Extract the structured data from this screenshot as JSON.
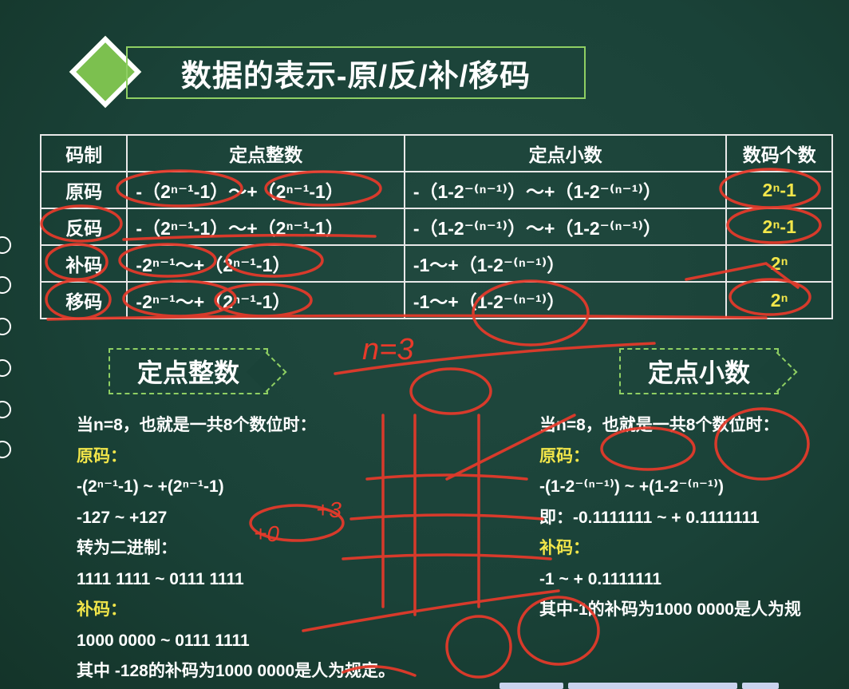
{
  "title": "数据的表示-原/反/补/移码",
  "table": {
    "headers": [
      "码制",
      "定点整数",
      "定点小数",
      "数码个数"
    ],
    "rows": [
      {
        "code": "原码",
        "int_range": "-（2ⁿ⁻¹-1）～+（2ⁿ⁻¹-1）",
        "dec_range": "-（1-2⁻⁽ⁿ⁻¹⁾）～+（1-2⁻⁽ⁿ⁻¹⁾）",
        "count": "2ⁿ-1"
      },
      {
        "code": "反码",
        "int_range": "-（2ⁿ⁻¹-1）～+（2ⁿ⁻¹-1）",
        "dec_range": "-（1-2⁻⁽ⁿ⁻¹⁾）～+（1-2⁻⁽ⁿ⁻¹⁾）",
        "count": "2ⁿ-1"
      },
      {
        "code": "补码",
        "int_range": "-2ⁿ⁻¹～+（2ⁿ⁻¹-1）",
        "dec_range": "-1～+（1-2⁻⁽ⁿ⁻¹⁾）",
        "count": "2ⁿ"
      },
      {
        "code": "移码",
        "int_range": "-2ⁿ⁻¹～+（2ⁿ⁻¹-1）",
        "dec_range": "-1～+（1-2⁻⁽ⁿ⁻¹⁾）",
        "count": "2ⁿ"
      }
    ]
  },
  "fixed_int": {
    "heading": "定点整数",
    "lines": [
      "当n=8，也就是一共8个数位时：",
      "原码：",
      "-(2ⁿ⁻¹-1) ~ +(2ⁿ⁻¹-1)",
      "-127 ~ +127",
      "转为二进制：",
      "1111 1111 ~ 0111 1111",
      "补码：",
      "1000 0000 ~ 0111 1111",
      "其中 -128的补码为1000 0000是人为规定。"
    ]
  },
  "fixed_dec": {
    "heading": "定点小数",
    "lines": [
      "当n=8，也就是一共8个数位时：",
      "原码：",
      "-(1-2⁻⁽ⁿ⁻¹⁾) ~ +(1-2⁻⁽ⁿ⁻¹⁾)",
      "即：-0.1111111 ~ + 0.1111111",
      "补码：",
      "-1 ~ + 0.1111111",
      "其中-1的补码为1000 0000是人为规"
    ]
  },
  "annotations": {
    "n_equals": "n=3",
    "plus_zero": "+0",
    "plus_three": "+3"
  },
  "colors": {
    "board": "#1a4238",
    "accent_green": "#8fcf63",
    "highlight_yellow": "#f2e64a",
    "ink_red": "#e83a2a"
  }
}
